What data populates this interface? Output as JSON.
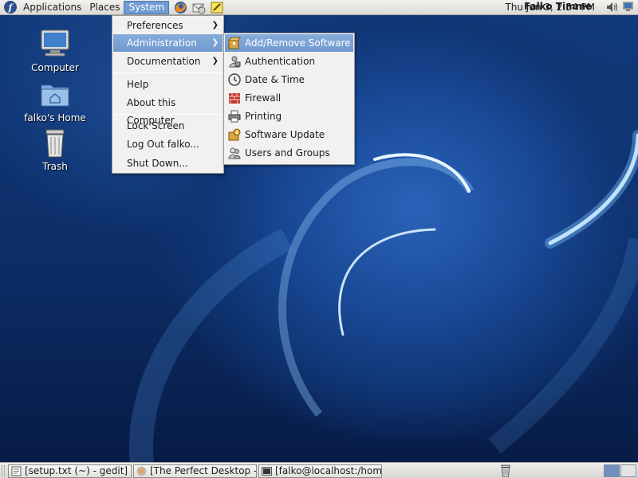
{
  "top_panel": {
    "menus": [
      "Applications",
      "Places",
      "System"
    ],
    "clock": "Thu Jun  3,  2:54 PM",
    "user": "Falko Timme"
  },
  "desktop_icons": [
    {
      "label": "Computer",
      "icon": "computer-icon"
    },
    {
      "label": "falko's Home",
      "icon": "home-folder-icon"
    },
    {
      "label": "Trash",
      "icon": "trash-icon"
    }
  ],
  "system_menu": {
    "items": [
      {
        "label": "Preferences",
        "submenu": true
      },
      {
        "label": "Administration",
        "submenu": true
      },
      {
        "label": "Documentation",
        "submenu": true
      },
      {
        "label": "Help"
      },
      {
        "label": "About this Computer"
      },
      {
        "label": "Lock Screen"
      },
      {
        "label": "Log Out falko..."
      },
      {
        "label": "Shut Down..."
      }
    ],
    "arrow": "❯"
  },
  "admin_menu": {
    "items": [
      {
        "label": "Add/Remove Software",
        "icon": "package-icon"
      },
      {
        "label": "Authentication",
        "icon": "authentication-icon"
      },
      {
        "label": "Date & Time",
        "icon": "clock-icon"
      },
      {
        "label": "Firewall",
        "icon": "firewall-icon"
      },
      {
        "label": "Printing",
        "icon": "printer-icon"
      },
      {
        "label": "Software Update",
        "icon": "software-update-icon"
      },
      {
        "label": "Users and Groups",
        "icon": "users-icon"
      }
    ]
  },
  "taskbar": {
    "tasks": [
      {
        "label": "[setup.txt (~) - gedit]",
        "icon": "gedit-icon"
      },
      {
        "label": "[The Perfect Desktop -...",
        "icon": "firefox-icon"
      },
      {
        "label": "[falko@localhost:/hom...",
        "icon": "terminal-icon"
      }
    ]
  },
  "colors": {
    "highlight": "#6f99cf",
    "panel": "#dcdad5",
    "desktop": "#123a7c"
  }
}
